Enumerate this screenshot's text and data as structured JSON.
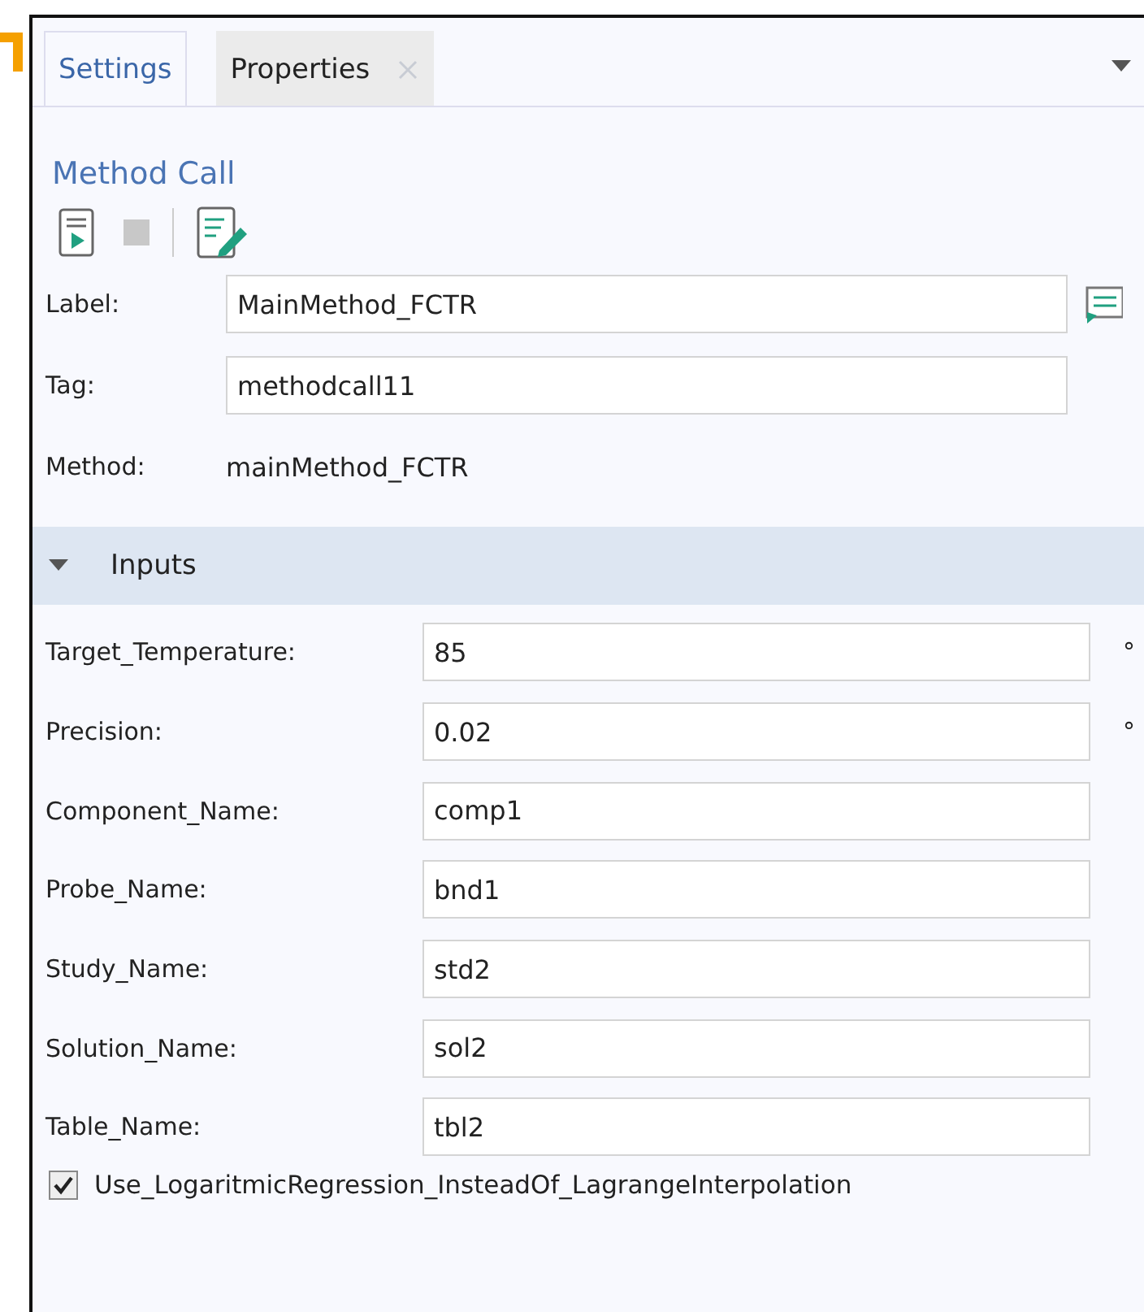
{
  "tabs": [
    {
      "label": "Settings",
      "selected": true,
      "closable": false
    },
    {
      "label": "Properties",
      "selected": false,
      "closable": true
    }
  ],
  "title": "Method Call",
  "fields": [
    {
      "label": "Label:",
      "value": "MainMethod_FCTR",
      "kind": "input"
    },
    {
      "label": "Tag:",
      "value": "methodcall11",
      "kind": "input"
    },
    {
      "label": "Method:",
      "value": "mainMethod_FCTR",
      "kind": "text"
    }
  ],
  "section": {
    "title": "Inputs",
    "expanded": true
  },
  "inputs": [
    {
      "label": "Target_Temperature:",
      "value": "85",
      "unit": "°"
    },
    {
      "label": "Precision:",
      "value": "0.02",
      "unit": "°"
    },
    {
      "label": "Component_Name:",
      "value": "comp1"
    },
    {
      "label": "Probe_Name:",
      "value": "bnd1"
    },
    {
      "label": "Study_Name:",
      "value": "std2"
    },
    {
      "label": "Solution_Name:",
      "value": "sol2"
    },
    {
      "label": "Table_Name:",
      "value": "tbl2"
    }
  ],
  "option": {
    "label": "Use_LogaritmicRegression_InsteadOf_LagrangeInterpolation",
    "checked": true
  }
}
